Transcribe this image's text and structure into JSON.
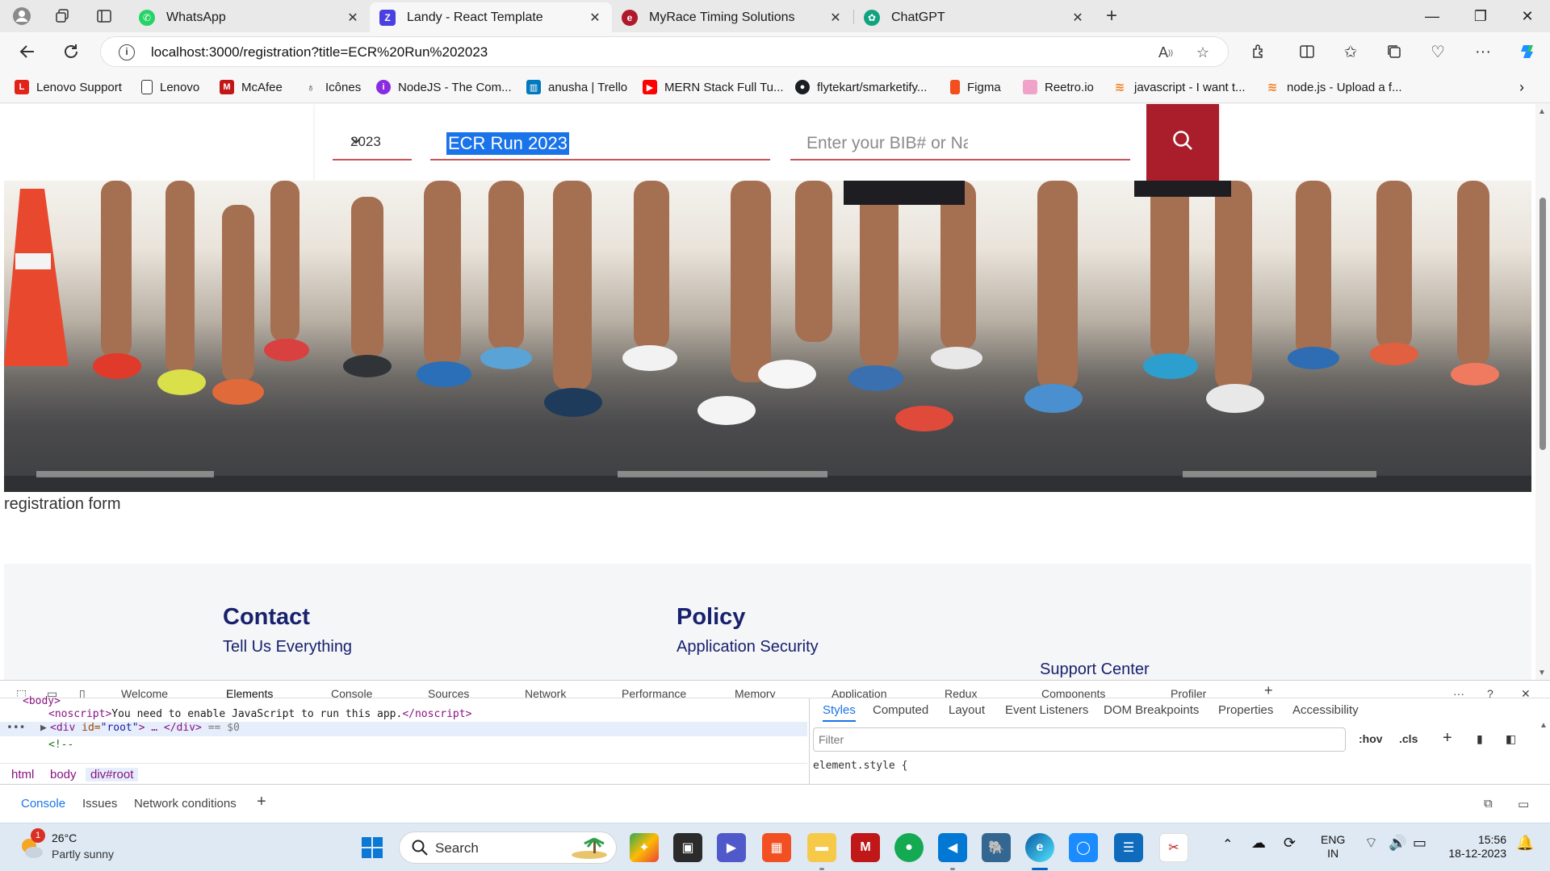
{
  "browser": {
    "tabs": [
      {
        "title": "WhatsApp",
        "icon": "whatsapp-icon",
        "color": "#25d366",
        "active": false
      },
      {
        "title": "Landy - React Template",
        "icon": "landy-icon",
        "color": "#4a3fe0",
        "active": true
      },
      {
        "title": "MyRace Timing Solutions",
        "icon": "myrace-icon",
        "color": "#b0182b",
        "active": false
      },
      {
        "title": "ChatGPT",
        "icon": "chatgpt-icon",
        "color": "#10a37f",
        "active": false
      }
    ],
    "url": "localhost:3000/registration?title=ECR%20Run%202023",
    "bookmarks": [
      {
        "label": "Lenovo Support",
        "icon": "lenovo-icon",
        "color": "#e2231a"
      },
      {
        "label": "Lenovo",
        "icon": "page-icon",
        "color": "#ffffff"
      },
      {
        "label": "McAfee",
        "icon": "mcafee-icon",
        "color": "#c01818"
      },
      {
        "label": "Icônes",
        "icon": "icones-icon",
        "color": "#ffffff"
      },
      {
        "label": "NodeJS - The Com...",
        "icon": "nodejs-icon",
        "color": "#8a2be2"
      },
      {
        "label": "anusha | Trello",
        "icon": "trello-icon",
        "color": "#0079bf"
      },
      {
        "label": "MERN Stack Full Tu...",
        "icon": "youtube-icon",
        "color": "#ff0000"
      },
      {
        "label": "flytekart/smarketify...",
        "icon": "github-icon",
        "color": "#1b1f23"
      },
      {
        "label": "Figma",
        "icon": "figma-icon",
        "color": "#f24e1e"
      },
      {
        "label": "Reetro.io",
        "icon": "reetro-icon",
        "color": "#f0a3c8"
      },
      {
        "label": "javascript - I want t...",
        "icon": "stackoverflow-icon",
        "color": "#f48024"
      },
      {
        "label": "node.js - Upload a f...",
        "icon": "stackoverflow-icon",
        "color": "#f48024"
      }
    ]
  },
  "page": {
    "search": {
      "year": "2023",
      "event_value": "ECR Run 2023",
      "bib_placeholder": "Enter your BIB# or Name"
    },
    "caption": "registration form",
    "footer": {
      "contact_heading": "Contact",
      "contact_link": "Tell Us Everything",
      "policy_heading": "Policy",
      "policy_link": "Application Security",
      "support_link": "Support Center"
    }
  },
  "devtools": {
    "tabs": [
      "Welcome",
      "Elements",
      "Console",
      "Sources",
      "Network",
      "Performance",
      "Memory",
      "Application",
      "Redux",
      "Components",
      "Profiler"
    ],
    "active_tab": "Elements",
    "code": {
      "body_tag": "<body>",
      "noscript_open": "<noscript>",
      "noscript_text": "You need to enable JavaScript to run this app.",
      "noscript_close": "</noscript>",
      "div_open": "<div ",
      "div_attr": "id=",
      "div_attr_val": "\"root\"",
      "div_close": "> … </div>",
      "div_eq": " == $0",
      "comment": "<!--"
    },
    "breadcrumbs": [
      "html",
      "body",
      "div#root"
    ],
    "styles_tabs": [
      "Styles",
      "Computed",
      "Layout",
      "Event Listeners",
      "DOM Breakpoints",
      "Properties",
      "Accessibility"
    ],
    "filter_placeholder": "Filter",
    "hov": ":hov",
    "cls": ".cls",
    "element_style": "element.style {",
    "drawer_tabs": [
      "Console",
      "Issues",
      "Network conditions"
    ]
  },
  "taskbar": {
    "weather_temp": "26°C",
    "weather_desc": "Partly sunny",
    "weather_badge": "1",
    "search_label": "Search",
    "lang": "ENG",
    "region": "IN",
    "time": "15:56",
    "date": "18-12-2023"
  }
}
